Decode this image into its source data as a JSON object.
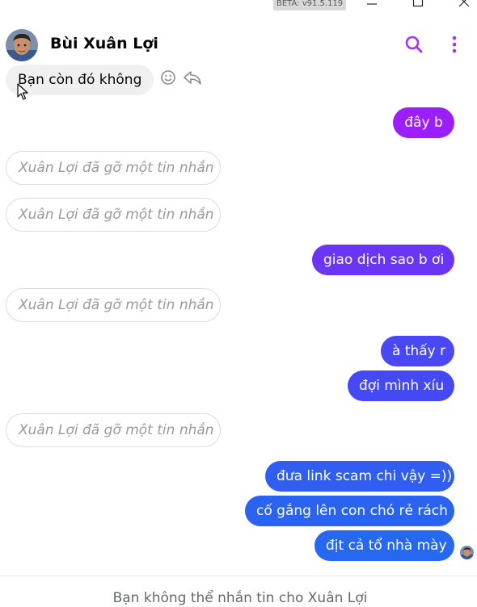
{
  "window": {
    "version_label": "BETA: v91.5.119"
  },
  "header": {
    "contact_name": "Bùi Xuân Lợi",
    "icons": {
      "search": "search-icon",
      "more": "more-vertical-icon"
    },
    "accent": "#a033ff"
  },
  "messages": [
    {
      "side": "incoming",
      "kind": "text",
      "text": "Bạn còn đó không"
    },
    {
      "side": "outgoing",
      "kind": "text",
      "text": "đây b",
      "color": "#9b1ffd"
    },
    {
      "side": "incoming",
      "kind": "removed",
      "text": "Xuân Lợi đã gỡ một tin nhắn"
    },
    {
      "side": "incoming",
      "kind": "removed",
      "text": "Xuân Lợi đã gỡ một tin nhắn"
    },
    {
      "side": "outgoing",
      "kind": "text",
      "text": "giao dịch sao b ơi",
      "color": "#6a35f5"
    },
    {
      "side": "incoming",
      "kind": "removed",
      "text": "Xuân Lợi đã gỡ một tin nhắn"
    },
    {
      "side": "outgoing",
      "kind": "text",
      "text": "à thấy r",
      "color": "#4a48f3"
    },
    {
      "side": "outgoing",
      "kind": "text",
      "text": "đợi mình xíu",
      "color": "#4449f3"
    },
    {
      "side": "incoming",
      "kind": "removed",
      "text": "Xuân Lợi đã gỡ một tin nhắn"
    },
    {
      "side": "outgoing",
      "kind": "text",
      "text": "đưa link scam chi vậy =))",
      "color": "#2f5ef0"
    },
    {
      "side": "outgoing",
      "kind": "text",
      "text": "cố gắng lên con chó rẻ rách",
      "color": "#2a63ef"
    },
    {
      "side": "outgoing",
      "kind": "text",
      "text": "địt cả tổ nhà mày",
      "color": "#2668ef"
    }
  ],
  "message_actions": {
    "react": "smiley-icon",
    "reply": "reply-icon"
  },
  "footer": {
    "notice": "Bạn không thể nhắn tin cho Xuân Lợi"
  }
}
